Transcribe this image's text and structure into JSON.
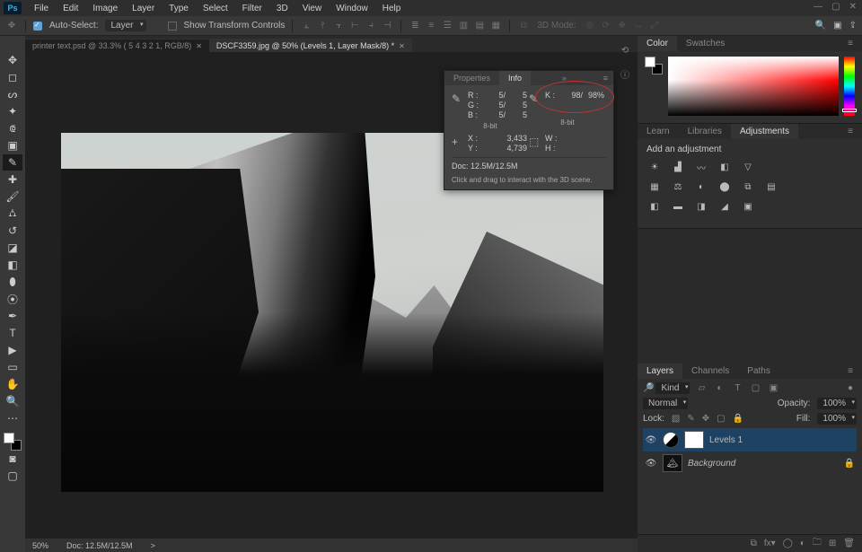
{
  "menu": [
    "File",
    "Edit",
    "Image",
    "Layer",
    "Type",
    "Select",
    "Filter",
    "3D",
    "View",
    "Window",
    "Help"
  ],
  "options": {
    "auto_select": "Auto-Select:",
    "target": "Layer",
    "show_transform": "Show Transform Controls",
    "mode3d": "3D Mode:"
  },
  "tabs": [
    {
      "label": "printer text.psd @ 33.3% (  5       4       3       2       1, RGB/8)",
      "active": false
    },
    {
      "label": "DSCF3359.jpg @ 50% (Levels 1, Layer Mask/8) *",
      "active": true
    }
  ],
  "status": {
    "zoom": "50%",
    "doc": "Doc: 12.5M/12.5M",
    "arrow": ">"
  },
  "info": {
    "tab_props": "Properties",
    "tab_info": "Info",
    "rgb": {
      "R": "5/",
      "Rv": "5",
      "G": "5/",
      "Gv": "5",
      "B": "5/",
      "Bv": "5",
      "bits": "8-bit"
    },
    "k": {
      "K": "98/",
      "Kv": "98%",
      "bits": "8-bit"
    },
    "xy": {
      "X": "3,433",
      "Y": "4,739"
    },
    "wh": {
      "W": "",
      "H": ""
    },
    "doc": "Doc: 12.5M/12.5M",
    "hint": "Click and drag to interact with the 3D scene."
  },
  "color": {
    "tab1": "Color",
    "tab2": "Swatches"
  },
  "adjust": {
    "tab1": "Learn",
    "tab2": "Libraries",
    "tab3": "Adjustments",
    "title": "Add an adjustment"
  },
  "layers": {
    "tab1": "Layers",
    "tab2": "Channels",
    "tab3": "Paths",
    "kind": "Kind",
    "blend": "Normal",
    "opacity_lbl": "Opacity:",
    "opacity": "100%",
    "lock_lbl": "Lock:",
    "fill_lbl": "Fill:",
    "fill": "100%",
    "layer_levels": "Levels 1",
    "layer_bg": "Background"
  }
}
